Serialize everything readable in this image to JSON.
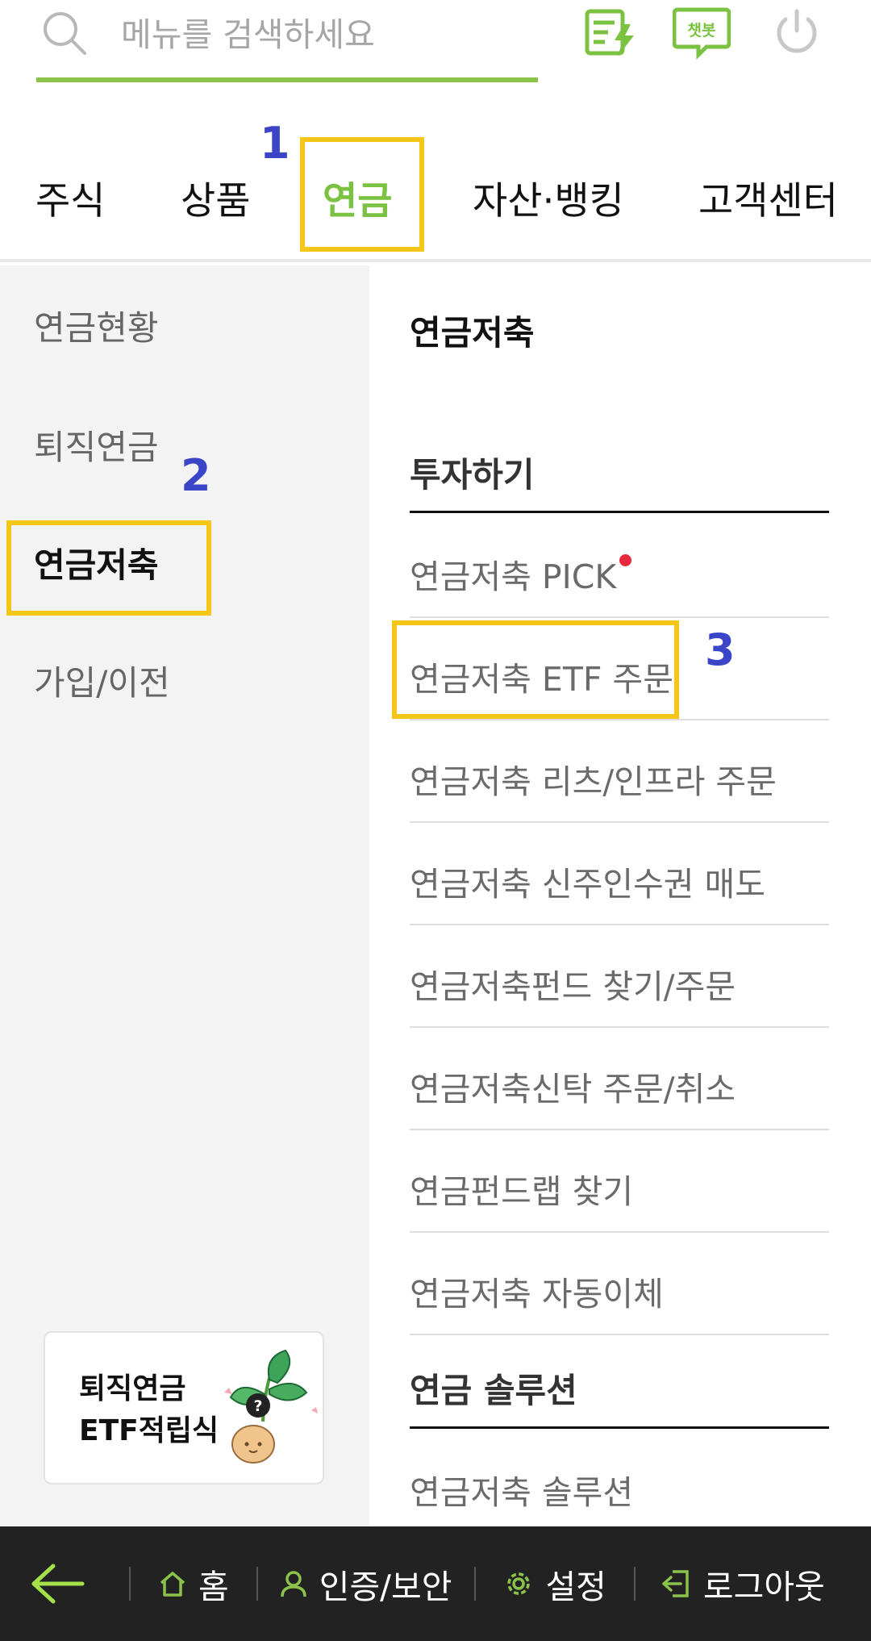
{
  "search": {
    "placeholder": "메뉴를 검색하세요"
  },
  "top_icons": {
    "chatbot_label": "챗봇"
  },
  "main_nav": {
    "tabs": [
      {
        "label": "주식"
      },
      {
        "label": "상품"
      },
      {
        "label": "연금"
      },
      {
        "label": "자산·뱅킹"
      },
      {
        "label": "고객센터"
      }
    ],
    "active": "연금"
  },
  "annotations": [
    "1",
    "2",
    "3"
  ],
  "left_menu": {
    "items": [
      {
        "label": "연금현황"
      },
      {
        "label": "퇴직연금"
      },
      {
        "label": "연금저축"
      },
      {
        "label": "가입/이전"
      }
    ],
    "active": "연금저축"
  },
  "promo": {
    "line1": "퇴직연금",
    "line2": "ETF적립식"
  },
  "right_panel": {
    "title": "연금저축",
    "sections": [
      {
        "heading": "투자하기",
        "items": [
          {
            "label": "연금저축 PICK"
          },
          {
            "label": "연금저축 ETF 주문"
          },
          {
            "label": "연금저축 리츠/인프라 주문"
          },
          {
            "label": "연금저축 신주인수권 매도"
          },
          {
            "label": "연금저축펀드 찾기/주문"
          },
          {
            "label": "연금저축신탁 주문/취소"
          },
          {
            "label": "연금펀드랩 찾기"
          },
          {
            "label": "연금저축 자동이체"
          }
        ]
      },
      {
        "heading": "연금 솔루션",
        "items": [
          {
            "label": "연금저축 솔루션"
          }
        ]
      }
    ]
  },
  "bottom_bar": {
    "home": "홈",
    "auth": "인증/보안",
    "settings": "설정",
    "logout": "로그아웃"
  },
  "colors": {
    "accent_green": "#7cc242",
    "annotation_box": "#f5c518",
    "annotation_number": "#3b45c8",
    "new_dot": "#e8283f",
    "bottom_bar_bg": "#222222"
  }
}
